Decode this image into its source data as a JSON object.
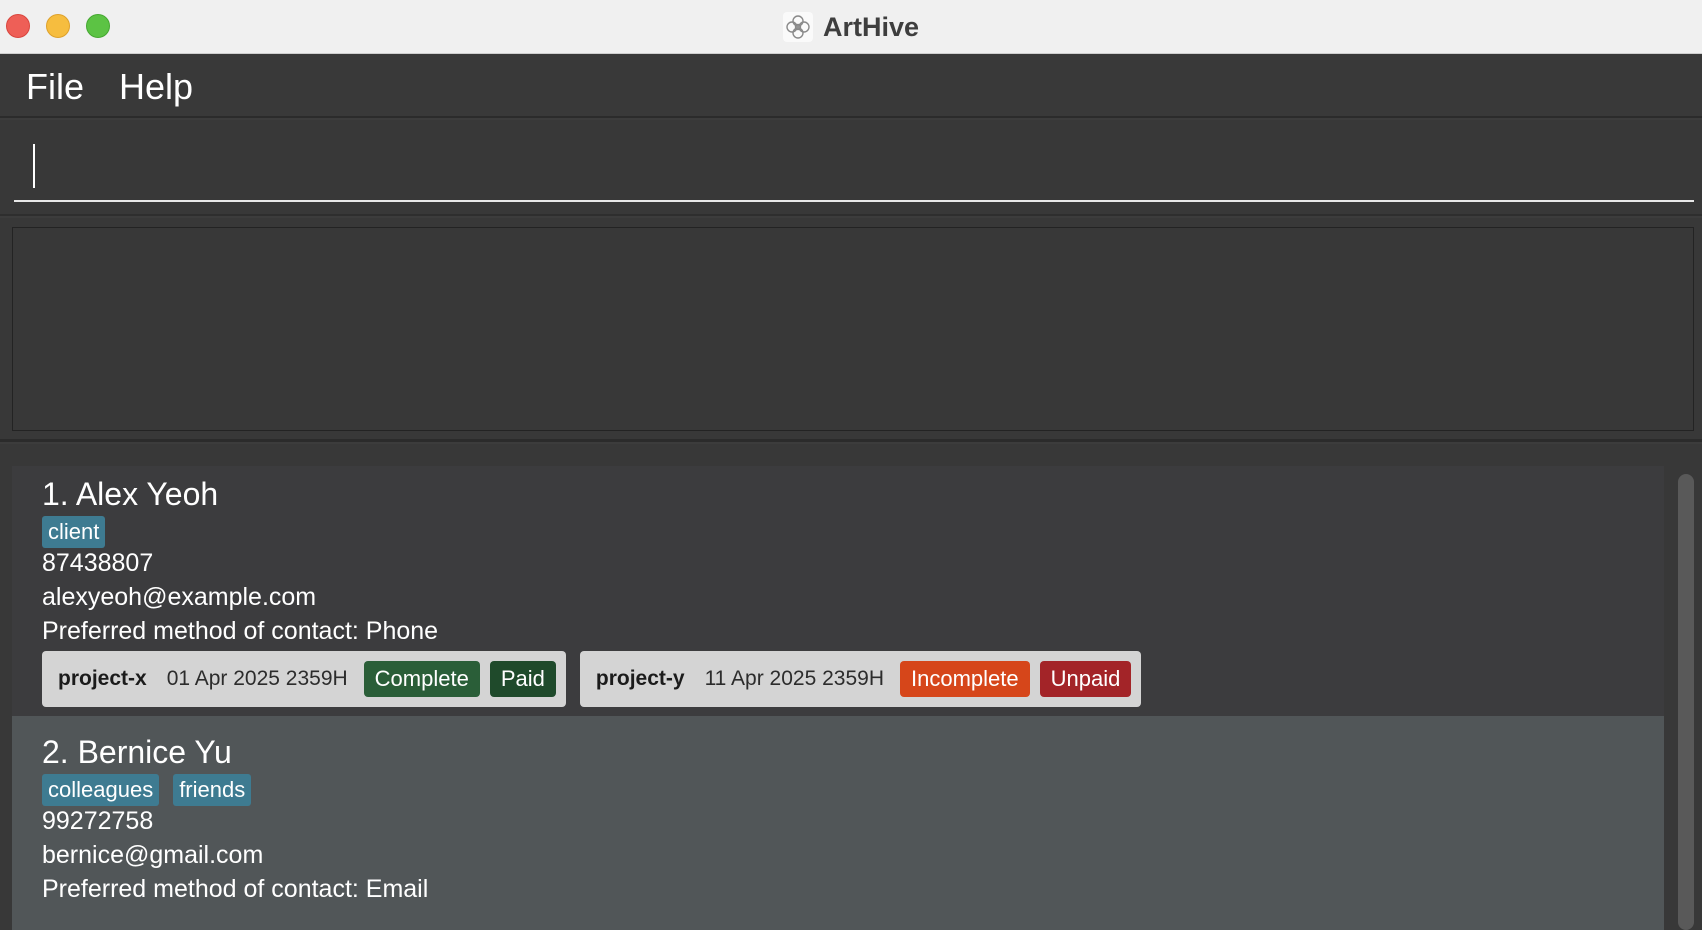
{
  "window": {
    "title": "ArtHive",
    "icon": "flower-icon"
  },
  "menu": {
    "items": [
      {
        "label": "File"
      },
      {
        "label": "Help"
      }
    ]
  },
  "command": {
    "value": "",
    "placeholder": ""
  },
  "result": {
    "text": ""
  },
  "persons": [
    {
      "name": "1. Alex Yeoh",
      "tags": [
        "client"
      ],
      "phone": "87438807",
      "email": "alexyeoh@example.com",
      "contact_pref": "Preferred method of contact: Phone",
      "projects": [
        {
          "name": "project-x",
          "deadline": "01 Apr 2025 2359H",
          "status": "Complete",
          "payment": "Paid"
        },
        {
          "name": "project-y",
          "deadline": "11 Apr 2025 2359H",
          "status": "Incomplete",
          "payment": "Unpaid"
        }
      ]
    },
    {
      "name": "2. Bernice Yu",
      "tags": [
        "colleagues",
        "friends"
      ],
      "phone": "99272758",
      "email": "bernice@gmail.com",
      "contact_pref": "Preferred method of contact: Email",
      "projects": []
    }
  ],
  "colors": {
    "complete": "#2a5e38",
    "paid": "#1f4a2b",
    "incomplete": "#d6461a",
    "unpaid": "#a32428",
    "tag": "#3e7b91"
  }
}
